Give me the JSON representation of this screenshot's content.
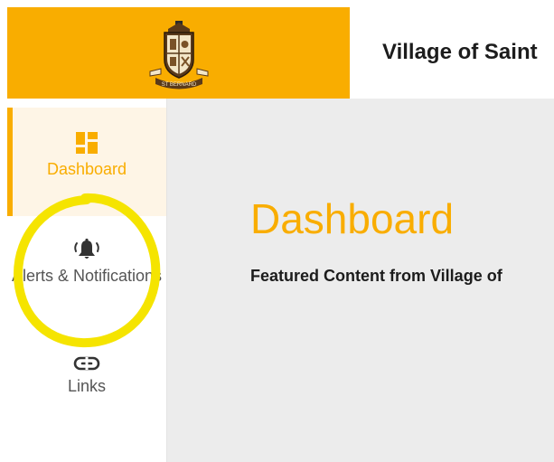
{
  "header": {
    "crest_icon": "village-crest-logo",
    "crest_banner_text": "ST BERNARD",
    "title": "Village of Saint"
  },
  "colors": {
    "brand": "#f9ad00",
    "active_bg": "#fef5e6",
    "content_bg": "#ececec",
    "highlight": "#f5e400",
    "text_muted": "#555555"
  },
  "sidebar": {
    "items": [
      {
        "label": "Dashboard",
        "icon": "dashboard-grid-icon",
        "active": true
      },
      {
        "label": "Alerts & Notifications",
        "icon": "bell-icon",
        "active": false
      },
      {
        "label": "Links",
        "icon": "link-icon",
        "active": false
      }
    ]
  },
  "main": {
    "title": "Dashboard",
    "subtitle": "Featured Content from Village of"
  }
}
